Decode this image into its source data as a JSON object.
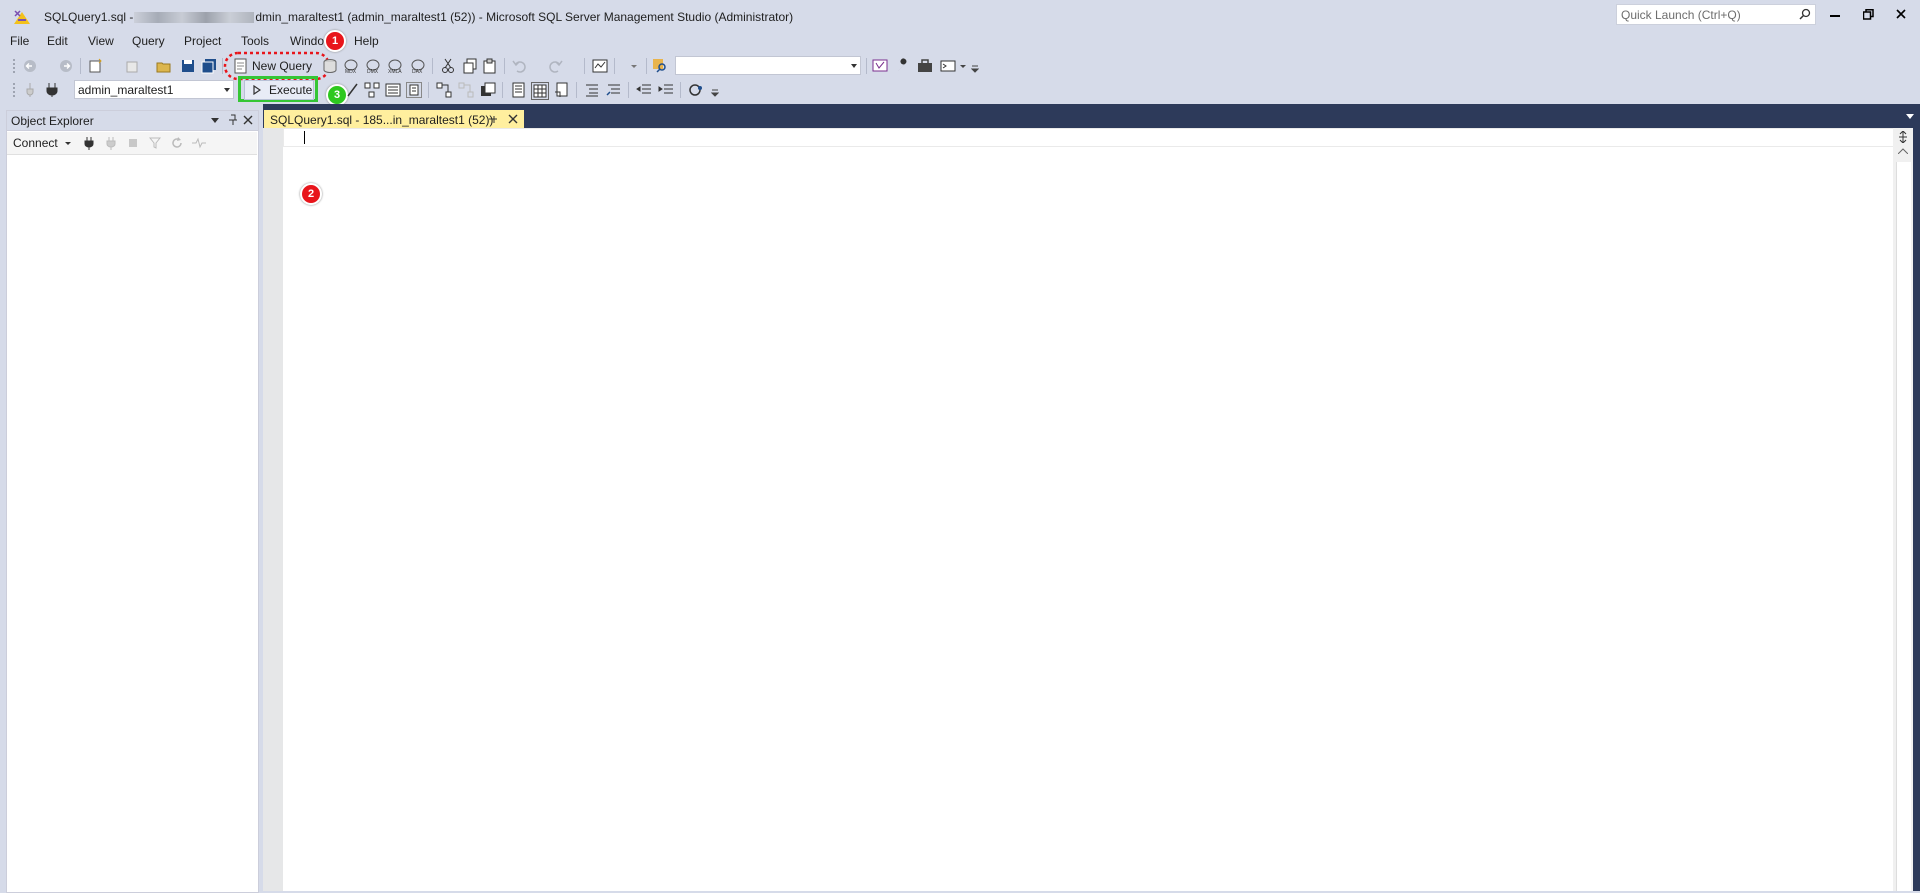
{
  "window": {
    "title_prefix": "SQLQuery1.sql -",
    "title_suffix": "dmin_maraltest1 (admin_maraltest1 (52)) - Microsoft SQL Server Management Studio (Administrator)",
    "quick_launch_placeholder": "Quick Launch (Ctrl+Q)"
  },
  "menu": {
    "items": [
      "File",
      "Edit",
      "View",
      "Query",
      "Project",
      "Tools",
      "Windo",
      "Help"
    ]
  },
  "toolbar": {
    "new_query_label": "New Query",
    "database_value": "admin_maraltest1",
    "execute_label": "Execute"
  },
  "annotations": {
    "badge1": "1",
    "badge2": "2",
    "badge3": "3"
  },
  "object_explorer": {
    "title": "Object Explorer",
    "connect_label": "Connect"
  },
  "document": {
    "tab_label": "SQLQuery1.sql - 185...in_maraltest1 (52))"
  },
  "colors": {
    "accent_dark": "#2d3a5a",
    "active_tab": "#ffef9e",
    "badge_red": "#e8151b",
    "badge_green": "#2ec81f",
    "highlight_green": "#35c635"
  }
}
